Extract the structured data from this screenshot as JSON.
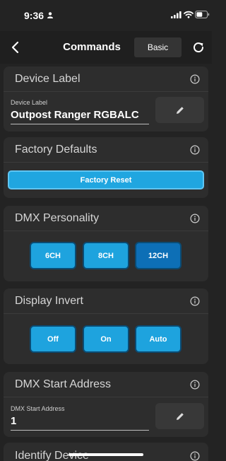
{
  "status_bar": {
    "time": "9:36"
  },
  "header": {
    "title": "Commands",
    "basic_label": "Basic"
  },
  "device_label": {
    "title": "Device Label",
    "field_label": "Device Label",
    "field_value": "Outpost Ranger RGBALC"
  },
  "factory_defaults": {
    "title": "Factory Defaults",
    "button_label": "Factory Reset"
  },
  "dmx_personality": {
    "title": "DMX Personality",
    "options": [
      "6CH",
      "8CH",
      "12CH"
    ],
    "selected": "12CH"
  },
  "display_invert": {
    "title": "Display Invert",
    "options": [
      "Off",
      "On",
      "Auto"
    ]
  },
  "dmx_start_address": {
    "title": "DMX Start Address",
    "field_label": "DMX Start Address",
    "field_value": "1"
  },
  "identify_device": {
    "title": "Identify Device"
  },
  "colors": {
    "accent": "#20a6e0",
    "selected": "#0d6fb6",
    "background": "#232323",
    "card": "#2d2d2d"
  },
  "icons": [
    "person-icon",
    "cellular-signal-icon",
    "wifi-icon",
    "battery-icon",
    "back-chevron-icon",
    "refresh-icon",
    "info-icon",
    "pencil-icon"
  ]
}
